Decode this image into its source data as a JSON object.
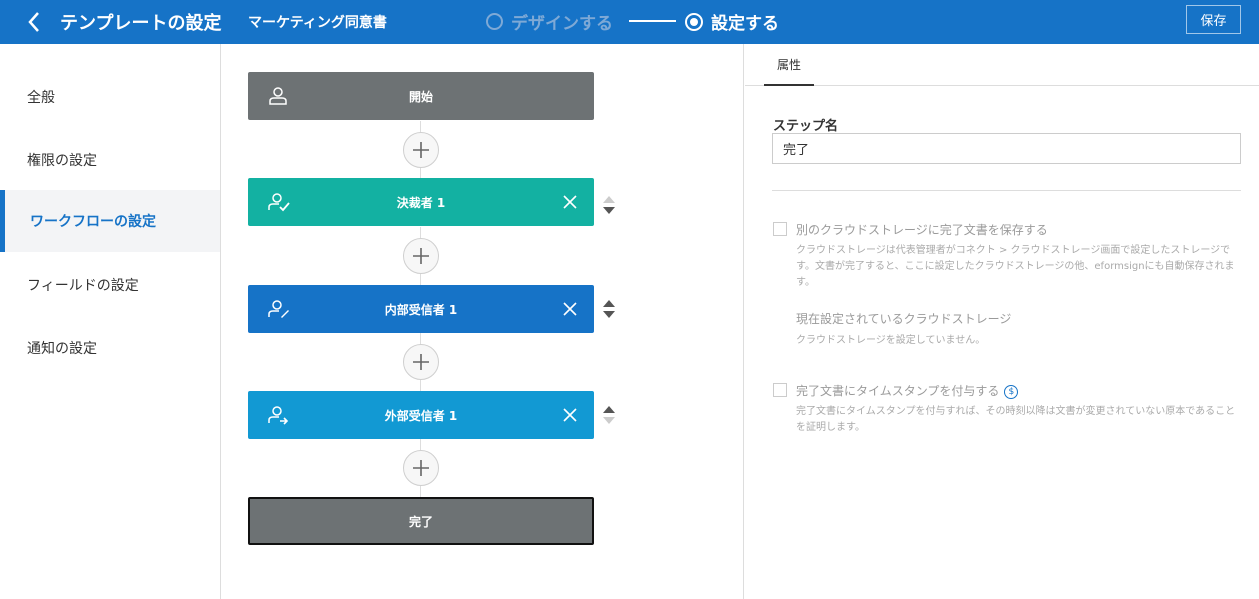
{
  "header": {
    "title": "テンプレートの設定",
    "document_name": "マーケティング同意書",
    "steps": [
      {
        "label": "デザインする",
        "active": false
      },
      {
        "label": "設定する",
        "active": true
      }
    ],
    "save_label": "保存",
    "accent_color": "#1673c7"
  },
  "sidebar": {
    "items": [
      {
        "label": "全般",
        "active": false
      },
      {
        "label": "権限の設定",
        "active": false
      },
      {
        "label": "ワークフローの設定",
        "active": true
      },
      {
        "label": "フィールドの設定",
        "active": false
      },
      {
        "label": "通知の設定",
        "active": false
      }
    ]
  },
  "workflow": {
    "steps": [
      {
        "label": "開始",
        "color": "#6d7274",
        "icon": "person-icon",
        "removable": false
      },
      {
        "label": "決裁者 1",
        "color": "#13b1a2",
        "icon": "person-check-icon",
        "removable": true
      },
      {
        "label": "内部受信者 1",
        "color": "#1673c7",
        "icon": "person-edit-icon",
        "removable": true
      },
      {
        "label": "外部受信者 1",
        "color": "#1299d3",
        "icon": "person-arrow-icon",
        "removable": true
      },
      {
        "label": "完了",
        "color": "#6d7274",
        "icon": "",
        "removable": false,
        "selected": true
      }
    ]
  },
  "panel": {
    "tab_label": "属性",
    "step_name_label": "ステップ名",
    "step_name_value": "完了",
    "cloud_option_label": "別のクラウドストレージに完了文書を保存する",
    "cloud_option_desc": "クラウドストレージは代表管理者がコネクト > クラウドストレージ画面で設定したストレージです。文書が完了すると、ここに設定したクラウドストレージの他、eformsignにも自動保存されます。",
    "current_storage_title": "現在設定されているクラウドストレージ",
    "current_storage_desc": "クラウドストレージを設定していません。",
    "timestamp_option_label": "完了文書にタイムスタンプを付与する",
    "timestamp_option_desc": "完了文書にタイムスタンプを付与すれば、その時刻以降は文書が変更されていない原本であることを証明します。",
    "paid_icon": "$"
  }
}
